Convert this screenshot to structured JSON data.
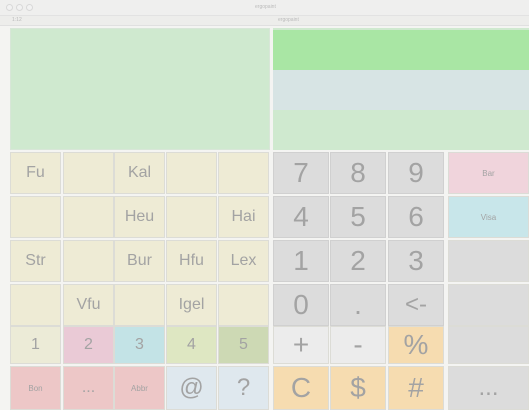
{
  "titlebar": {
    "left_text": "1:12",
    "right_text": "ergopaint"
  },
  "word_keys": [
    [
      "Fu",
      "",
      "Kal",
      "",
      ""
    ],
    [
      "",
      "",
      "Heu",
      "",
      "Hai"
    ],
    [
      "Str",
      "",
      "Bur",
      "Hfu",
      "Lex"
    ],
    [
      "",
      "Vfu",
      "",
      "Igel",
      ""
    ]
  ],
  "number_row": [
    "1",
    "2",
    "3",
    "4",
    "5"
  ],
  "bottom_row": [
    "Bon",
    "...",
    "Abbr",
    "@",
    "?"
  ],
  "numpad": [
    [
      "7",
      "8",
      "9"
    ],
    [
      "4",
      "5",
      "6"
    ],
    [
      "1",
      "2",
      "3"
    ],
    [
      "0",
      ".",
      "<-"
    ],
    [
      "+",
      "-",
      "%"
    ],
    [
      "C",
      "$",
      "#"
    ]
  ],
  "side_keys": [
    "Bar",
    "Visa",
    "",
    "",
    "",
    "..."
  ],
  "colors": {
    "number_row": [
      "#ecebd7",
      "#eacad6",
      "#c3e3e6",
      "#dee7c2",
      "#cdd9b4"
    ],
    "bottom_row": [
      "#edc7c7",
      "#edc7c7",
      "#edc7c7",
      "#dfe8ee",
      "#dfe8ee"
    ],
    "accent_orange": "#f6dcb0",
    "side": [
      "#f0d4dc",
      "#c8e6ea",
      "#dcdcdc",
      "#dcdcdc",
      "#dcdcdc",
      "#dcdcdc"
    ]
  }
}
